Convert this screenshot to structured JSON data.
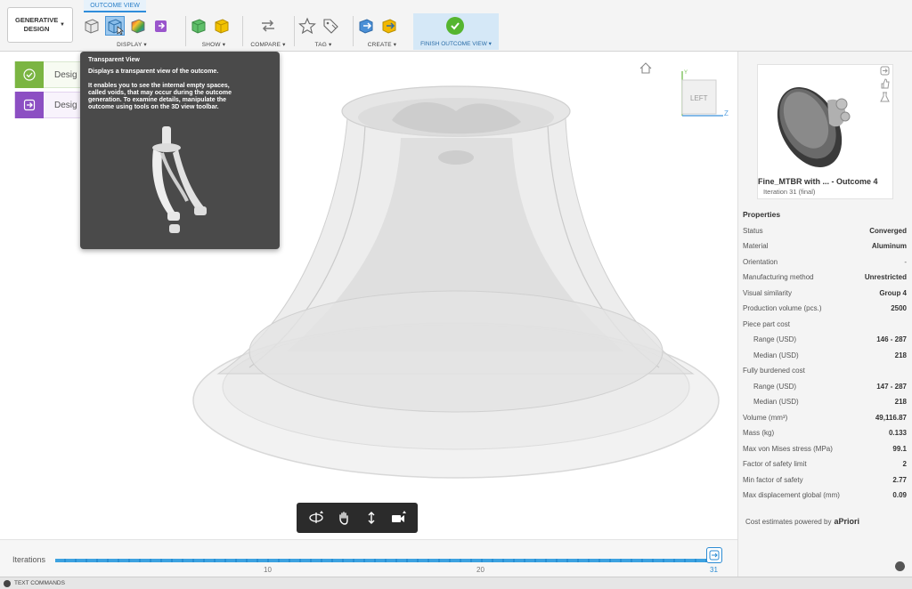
{
  "toolbar": {
    "workspace": "GENERATIVE DESIGN",
    "context_tab": "OUTCOME VIEW",
    "groups": {
      "display": "DISPLAY ▾",
      "show": "SHOW ▾",
      "compare": "COMPARE ▾",
      "tag": "TAG ▾",
      "create": "CREATE ▾",
      "finish": "FINISH OUTCOME VIEW ▾"
    }
  },
  "browser": {
    "items": [
      {
        "label": "Desig",
        "color": "#7bb542",
        "icon": "check-icon"
      },
      {
        "label": "Desig",
        "color": "#8c4fc3",
        "icon": "exit-icon"
      }
    ]
  },
  "tooltip": {
    "title": "Transparent View",
    "line1": "Displays a transparent view of the outcome.",
    "body": [
      "It enables you to see the internal empty spaces,",
      "called voids, that may occur during the outcome",
      "generation. To examine details, manipulate the",
      "outcome using tools on the 3D view toolbar."
    ]
  },
  "viewcube": {
    "face": "LEFT",
    "axis_z": "Z",
    "axis_y": "Y"
  },
  "outcome": {
    "title": "Fine_MTBR with ...  - Outcome 4",
    "subtitle": "Iteration 31 (final)"
  },
  "properties": {
    "title": "Properties",
    "rows": [
      {
        "label": "Status",
        "value": "Converged",
        "indent": false
      },
      {
        "label": "Material",
        "value": "Aluminum",
        "indent": false
      },
      {
        "label": "Orientation",
        "value": "-",
        "indent": false
      },
      {
        "label": "Manufacturing method",
        "value": "Unrestricted",
        "indent": false
      },
      {
        "label": "Visual similarity",
        "value": "Group 4",
        "indent": false
      },
      {
        "label": "Production volume (pcs.)",
        "value": "2500",
        "indent": false
      },
      {
        "label": "Piece part cost",
        "value": "",
        "indent": false
      },
      {
        "label": "Range (USD)",
        "value": "146 - 287",
        "indent": true
      },
      {
        "label": "Median (USD)",
        "value": "218",
        "indent": true
      },
      {
        "label": "Fully burdened cost",
        "value": "",
        "indent": false
      },
      {
        "label": "Range (USD)",
        "value": "147 - 287",
        "indent": true
      },
      {
        "label": "Median (USD)",
        "value": "218",
        "indent": true
      },
      {
        "label": "Volume (mm³)",
        "value": "49,116.87",
        "indent": false
      },
      {
        "label": "Mass (kg)",
        "value": "0.133",
        "indent": false
      },
      {
        "label": "Max von Mises stress (MPa)",
        "value": "99.1",
        "indent": false
      },
      {
        "label": "Factor of safety limit",
        "value": "2",
        "indent": false
      },
      {
        "label": "Min factor of safety",
        "value": "2.77",
        "indent": false
      },
      {
        "label": "Max displacement global (mm)",
        "value": "0.09",
        "indent": false
      }
    ],
    "powered_by": "Cost estimates powered by",
    "powered_logo": "aPriori"
  },
  "timeline": {
    "label": "Iterations",
    "ticks": [
      "10",
      "20",
      "31"
    ],
    "current": "31"
  },
  "text_commands": "TEXT COMMANDS"
}
